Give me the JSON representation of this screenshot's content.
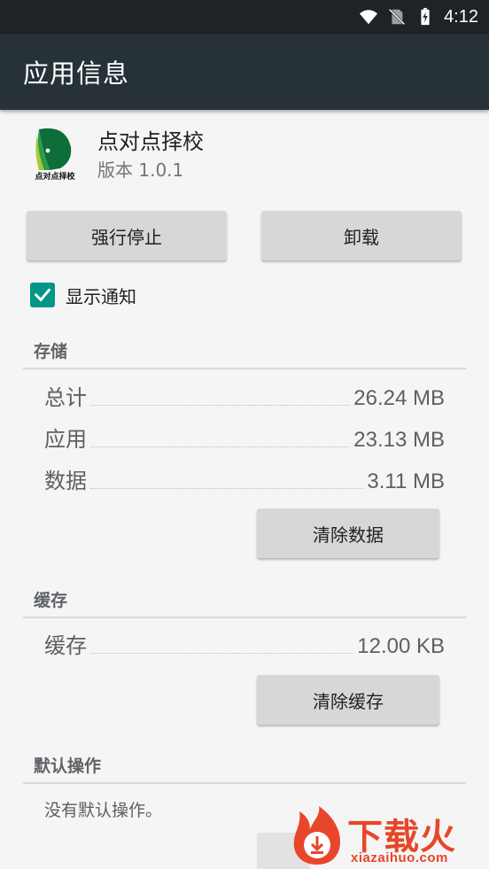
{
  "status_bar": {
    "time": "4:12",
    "icons": [
      "wifi-icon",
      "no-sim-icon",
      "battery-charging-icon"
    ]
  },
  "app_bar": {
    "title": "应用信息"
  },
  "app": {
    "name": "点对点择校",
    "version": "版本 1.0.1",
    "icon_label": "点对点择校",
    "icon_colors": [
      "#0d6e3a",
      "#2e9a4a",
      "#a8c93a"
    ]
  },
  "actions": {
    "force_stop_label": "强行停止",
    "uninstall_label": "卸载"
  },
  "notifications": {
    "label": "显示通知",
    "checked": true,
    "accent": "#009688"
  },
  "storage": {
    "title": "存储",
    "rows": [
      {
        "label": "总计",
        "value": "26.24 MB"
      },
      {
        "label": "应用",
        "value": "23.13 MB"
      },
      {
        "label": "数据",
        "value": "3.11 MB"
      }
    ],
    "clear_label": "清除数据"
  },
  "cache": {
    "title": "缓存",
    "rows": [
      {
        "label": "缓存",
        "value": "12.00 KB"
      }
    ],
    "clear_label": "清除缓存"
  },
  "defaults": {
    "title": "默认操作",
    "text": "没有默认操作。"
  },
  "watermark": {
    "brand": "下载火",
    "url": "xiazaihuo.com",
    "color": "#e8462a"
  }
}
